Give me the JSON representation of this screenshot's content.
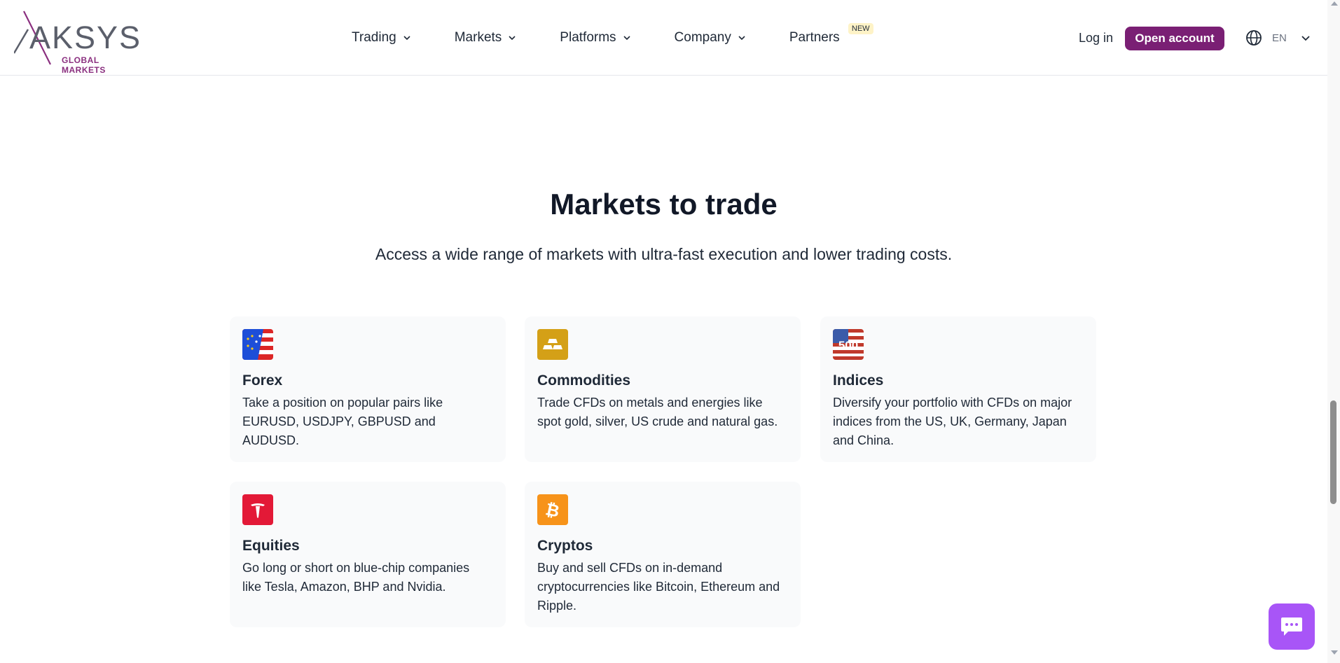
{
  "brand": {
    "logo_text": "AKSYS",
    "logo_sub": "GLOBAL MARKETS"
  },
  "nav": [
    {
      "label": "Trading",
      "has_dropdown": true
    },
    {
      "label": "Markets",
      "has_dropdown": true
    },
    {
      "label": "Platforms",
      "has_dropdown": true
    },
    {
      "label": "Company",
      "has_dropdown": true
    },
    {
      "label": "Partners",
      "has_dropdown": false,
      "badge": "NEW"
    }
  ],
  "header_actions": {
    "login_label": "Log in",
    "open_account_label": "Open account",
    "language": "EN"
  },
  "section": {
    "title": "Markets to trade",
    "subtitle": "Access a wide range of markets with ultra-fast execution and lower trading costs."
  },
  "markets": [
    {
      "title": "Forex",
      "description": "Take a position on popular pairs like EURUSD, USDJPY, GBPUSD and AUDUSD.",
      "icon": "forex-flag-icon"
    },
    {
      "title": "Commodities",
      "description": "Trade CFDs on metals and energies like spot gold, silver, US crude and natural gas.",
      "icon": "gold-bars-icon"
    },
    {
      "title": "Indices",
      "description": "Diversify your portfolio with CFDs on major indices from the US, UK, Germany, Japan and China.",
      "icon": "sp500-icon",
      "icon_text": "500"
    },
    {
      "title": "Equities",
      "description": "Go long or short on blue-chip companies like Tesla, Amazon, BHP and Nvidia.",
      "icon": "tesla-icon"
    },
    {
      "title": "Cryptos",
      "description": "Buy and sell CFDs on in-demand cryptocurrencies like Bitcoin, Ethereum and Ripple.",
      "icon": "bitcoin-icon"
    }
  ],
  "colors": {
    "brand_purple": "#7a1f74",
    "chat_purple": "#a855f7",
    "card_bg": "#f9fafb"
  }
}
